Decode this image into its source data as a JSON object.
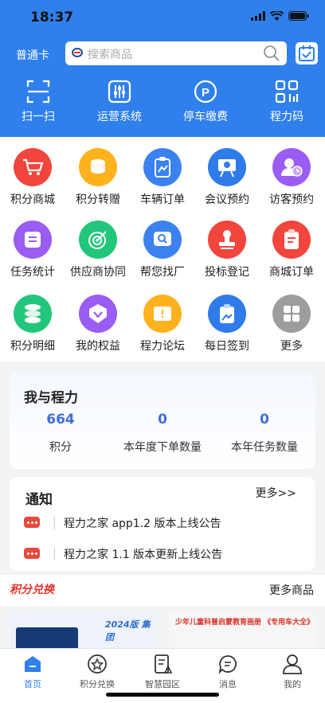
{
  "status": {
    "time": "18:37"
  },
  "header": {
    "card_type": "普通卡",
    "search_placeholder": "搜索商品",
    "quick_actions": [
      {
        "label": "扫一扫",
        "icon": "scan-icon"
      },
      {
        "label": "运营系统",
        "icon": "sliders-icon"
      },
      {
        "label": "停车缴费",
        "icon": "parking-icon"
      },
      {
        "label": "程力码",
        "icon": "qr-code-icon"
      }
    ]
  },
  "grid": [
    {
      "label": "积分商城",
      "icon": "cart-icon",
      "color": "#f2453d"
    },
    {
      "label": "积分转赠",
      "icon": "coins-icon",
      "color": "#ffb21d"
    },
    {
      "label": "车辆订单",
      "icon": "clipboard-icon",
      "color": "#3b82f0"
    },
    {
      "label": "会议预约",
      "icon": "projector-icon",
      "color": "#2f7bea"
    },
    {
      "label": "访客预约",
      "icon": "visitor-icon",
      "color": "#9a5cf2"
    },
    {
      "label": "任务统计",
      "icon": "list-icon",
      "color": "#9a5cf2"
    },
    {
      "label": "供应商协同",
      "icon": "target-icon",
      "color": "#22c67a"
    },
    {
      "label": "帮您找厂",
      "icon": "search-factory-icon",
      "color": "#3b82f0"
    },
    {
      "label": "投标登记",
      "icon": "stamp-icon",
      "color": "#f2453d"
    },
    {
      "label": "商城订单",
      "icon": "order-icon",
      "color": "#f2453d"
    },
    {
      "label": "积分明细",
      "icon": "database-icon",
      "color": "#22c67a"
    },
    {
      "label": "我的权益",
      "icon": "badge-icon",
      "color": "#9a5cf2"
    },
    {
      "label": "程力论坛",
      "icon": "forum-icon",
      "color": "#ffb21d"
    },
    {
      "label": "每日签到",
      "icon": "checkin-icon",
      "color": "#2f7bea"
    },
    {
      "label": "更多",
      "icon": "more-grid-icon",
      "color": "#9d9d9d"
    }
  ],
  "mine": {
    "title": "我与程力",
    "stats": [
      {
        "value": "664",
        "label": "积分"
      },
      {
        "value": "0",
        "label": "本年度下单数量"
      },
      {
        "value": "0",
        "label": "本年任务数量"
      }
    ]
  },
  "notice": {
    "title": "通知",
    "more": "更多>>",
    "items": [
      "程力之家 app1.2 版本上线公告",
      "程力之家 1.1 版本更新上线公告"
    ]
  },
  "exchange": {
    "title": "积分兑换",
    "more": "更多商品",
    "products": [
      {
        "caption": "2024版 集团",
        "color": "#1d4fa8"
      },
      {
        "caption": "少年儿童科普启蒙教育画册 《专用车大全》",
        "color": "#d7342a"
      }
    ]
  },
  "tabbar": [
    {
      "label": "首页",
      "icon": "home-icon",
      "active": true
    },
    {
      "label": "积分兑换",
      "icon": "star-icon"
    },
    {
      "label": "智慧园区",
      "icon": "park-icon"
    },
    {
      "label": "消息",
      "icon": "message-icon"
    },
    {
      "label": "我的",
      "icon": "user-icon"
    }
  ],
  "colors": {
    "primary": "#2f80ed",
    "stat": "#3d6fd8",
    "accent": "#e8322b"
  }
}
